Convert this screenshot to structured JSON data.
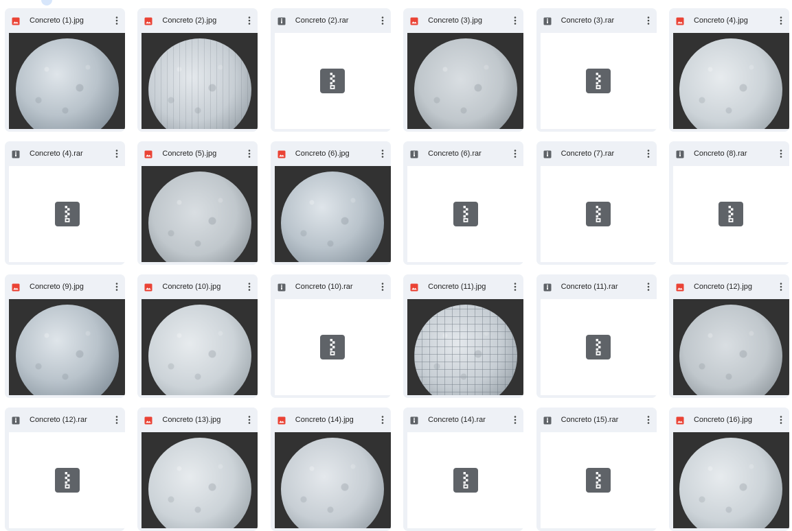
{
  "icons": {
    "image": "image-file-icon",
    "archive": "archive-file-icon",
    "more": "more-vert-icon",
    "zip": "zipper-icon"
  },
  "colors": {
    "image_icon": "#ea4335",
    "archive_icon": "#5f6368",
    "card_bg": "#eef1f6",
    "photo_bg": "#323232"
  },
  "files": [
    {
      "name": "Concreto (1).jpg",
      "type": "image",
      "texture": "a"
    },
    {
      "name": "Concreto (2).jpg",
      "type": "image",
      "texture": "b-lined"
    },
    {
      "name": "Concreto (2).rar",
      "type": "archive"
    },
    {
      "name": "Concreto (3).jpg",
      "type": "image",
      "texture": "c"
    },
    {
      "name": "Concreto (3).rar",
      "type": "archive"
    },
    {
      "name": "Concreto (4).jpg",
      "type": "image",
      "texture": "d"
    },
    {
      "name": "Concreto (4).rar",
      "type": "archive"
    },
    {
      "name": "Concreto (5).jpg",
      "type": "image",
      "texture": "c"
    },
    {
      "name": "Concreto (6).jpg",
      "type": "image",
      "texture": "a"
    },
    {
      "name": "Concreto (6).rar",
      "type": "archive"
    },
    {
      "name": "Concreto (7).rar",
      "type": "archive"
    },
    {
      "name": "Concreto (8).rar",
      "type": "archive"
    },
    {
      "name": "Concreto (9).jpg",
      "type": "image",
      "texture": "a"
    },
    {
      "name": "Concreto (10).jpg",
      "type": "image",
      "texture": "d"
    },
    {
      "name": "Concreto (10).rar",
      "type": "archive"
    },
    {
      "name": "Concreto (11).jpg",
      "type": "image",
      "texture": "b-tiles"
    },
    {
      "name": "Concreto (11).rar",
      "type": "archive"
    },
    {
      "name": "Concreto (12).jpg",
      "type": "image",
      "texture": "c"
    },
    {
      "name": "Concreto (12).rar",
      "type": "archive"
    },
    {
      "name": "Concreto (13).jpg",
      "type": "image",
      "texture": "d"
    },
    {
      "name": "Concreto (14).jpg",
      "type": "image",
      "texture": "b"
    },
    {
      "name": "Concreto (14).rar",
      "type": "archive"
    },
    {
      "name": "Concreto (15).rar",
      "type": "archive"
    },
    {
      "name": "Concreto (16).jpg",
      "type": "image",
      "texture": "d"
    }
  ]
}
